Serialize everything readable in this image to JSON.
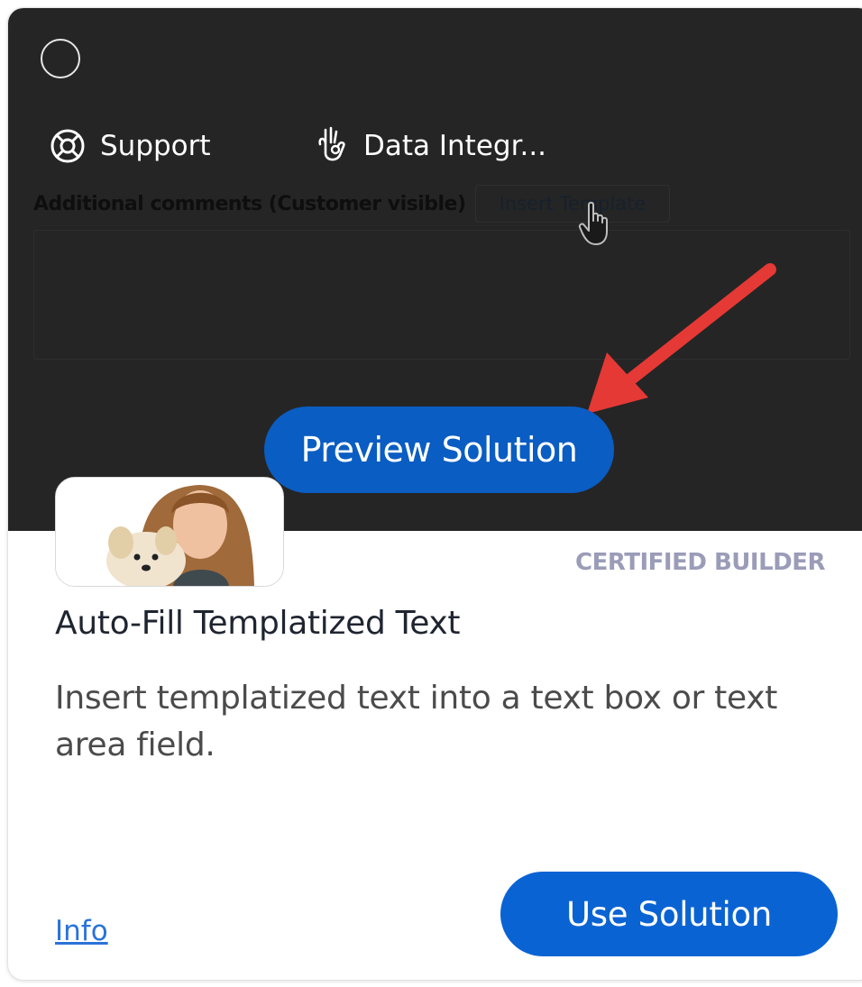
{
  "preview": {
    "nav": [
      {
        "label": "Support",
        "icon": "lifebuoy-icon"
      },
      {
        "label": "Data Integr...",
        "icon": "ok-hand-icon"
      }
    ],
    "background_label": "Additional comments (Customer visible)",
    "background_button": "Insert Template",
    "preview_button": "Preview Solution"
  },
  "card": {
    "badge": "CERTIFIED BUILDER",
    "title": "Auto-Fill Templatized Text",
    "description": "Insert templatized text into a text box or text area field.",
    "info_link": "Info",
    "use_button": "Use Solution"
  },
  "colors": {
    "preview_bg": "#252525",
    "primary_button": "#0a5dc2",
    "annotation_arrow": "#e53935",
    "badge_text": "#9a9cb8",
    "link": "#2a73d9"
  }
}
